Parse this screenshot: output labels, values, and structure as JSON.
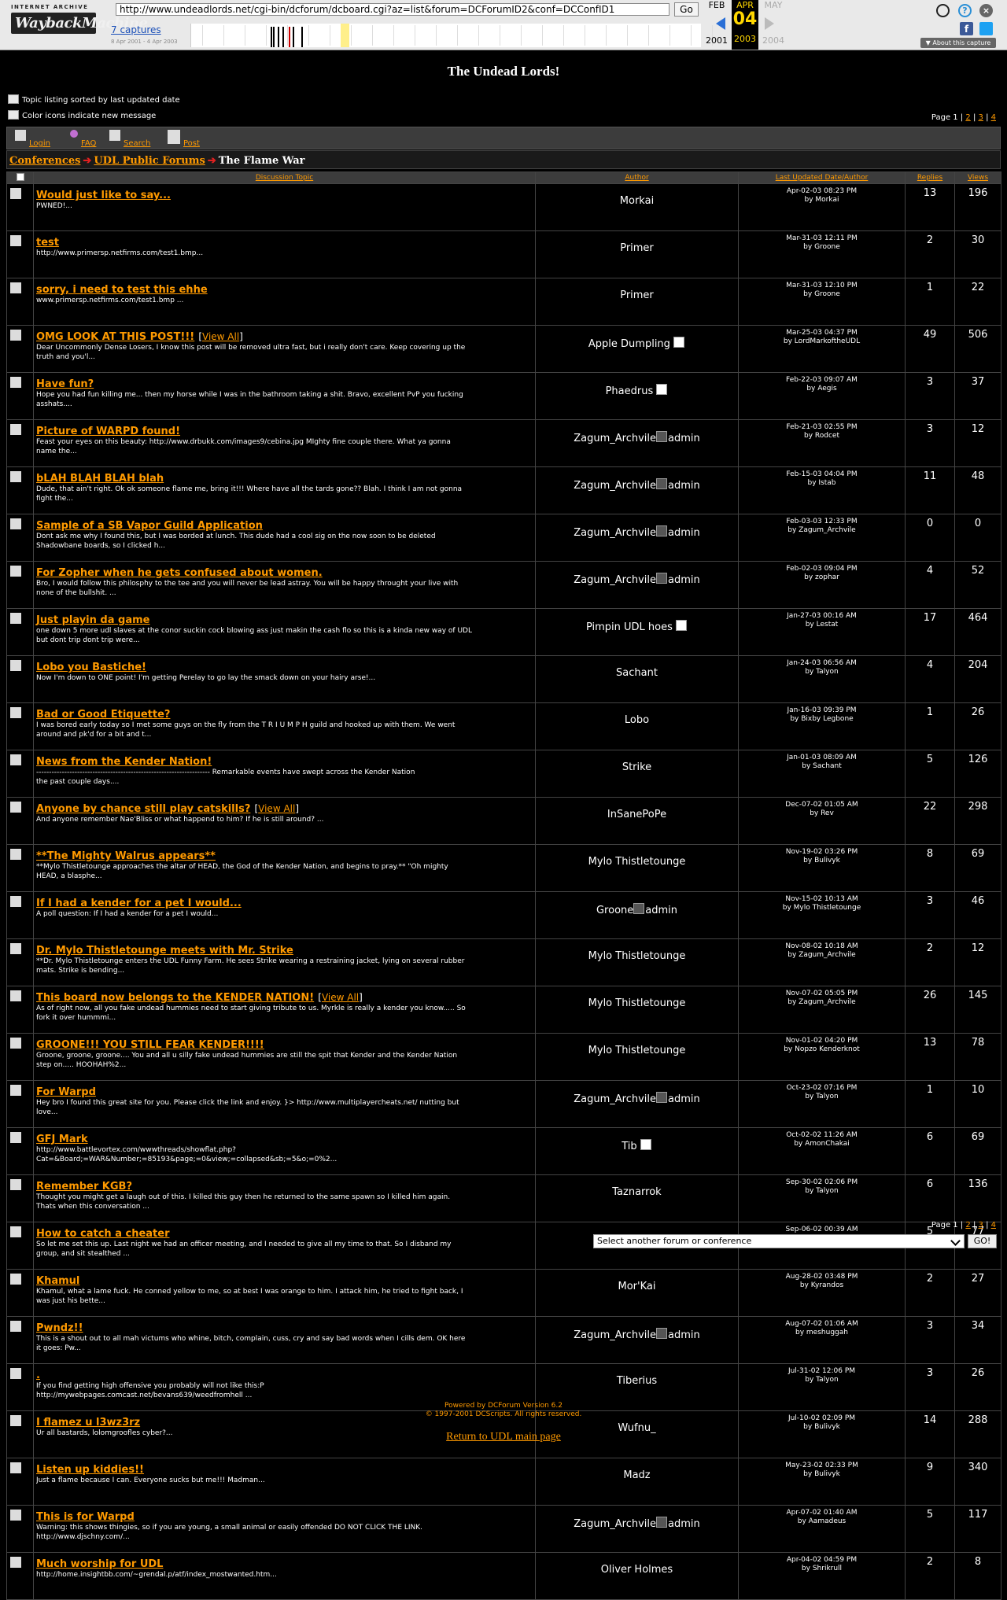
{
  "wayback": {
    "logo_top": "INTERNET ARCHIVE",
    "logo_main": "WaybackMachine",
    "url": "http://www.undeadlords.net/cgi-bin/dcforum/dcboard.cgi?az=list&forum=DCForumID2&conf=DCConfID1",
    "go_label": "Go",
    "captures_label": "7 captures",
    "date_range": "8 Apr 2001 - 4 Apr 2003",
    "prev_month": "FEB",
    "prev_year": "2001",
    "cur_month": "APR",
    "cur_day": "04",
    "cur_year": "2003",
    "next_month": "MAY",
    "next_year": "2004",
    "about_label": "About this capture"
  },
  "forum": {
    "title": "The Undead Lords!",
    "note_sorted": "Topic listing sorted by last updated date",
    "note_icons": "Color icons indicate new message",
    "pages_label": "Page 1",
    "page_links": [
      "2",
      "3",
      "4"
    ],
    "toolbar": {
      "login": "Login",
      "faq": "FAQ",
      "search": "Search",
      "post": "Post"
    },
    "breadcrumb": {
      "conferences": "Conferences",
      "public": "UDL Public Forums",
      "current": "The Flame War"
    },
    "columns": {
      "topic": "Discussion Topic",
      "author": "Author",
      "last_updated": "Last Updated Date/Author",
      "replies": "Replies",
      "views": "Views"
    },
    "select_placeholder": "Select another forum or conference",
    "go_button": "GO!",
    "powered": "Powered by DCForum Version 6.2",
    "copyright": "© 1997-2001 DCScripts. All rights reserved.",
    "return_link": "Return to UDL main page"
  },
  "topics": [
    {
      "title": "Would just like to say...",
      "excerpt": [
        "PWNED!..."
      ],
      "author": "Morkai",
      "date": "Apr-02-03 08:23 PM",
      "by": "by Morkai",
      "replies": "13",
      "views": "196"
    },
    {
      "title": "test",
      "excerpt": [
        "http://www.primersp.netfirms.com/test1.bmp..."
      ],
      "author": "Primer",
      "date": "Mar-31-03 12:11 PM",
      "by": "by Groone",
      "replies": "2",
      "views": "30"
    },
    {
      "title": "sorry, i need to test this ehhe",
      "excerpt": [
        "www.primersp.netfirms.com/test1.bmp ..."
      ],
      "author": "Primer",
      "date": "Mar-31-03 12:10 PM",
      "by": "by Groone",
      "replies": "1",
      "views": "22"
    },
    {
      "title": "OMG LOOK AT THIS POST!!!",
      "view_all": "View All",
      "excerpt": [
        "Dear Uncommonly Dense Losers, I know this post will be removed ultra fast, but i really don't care. Keep covering up the",
        "truth and you'l..."
      ],
      "author": "Apple Dumpling",
      "author_img": true,
      "date": "Mar-25-03 04:37 PM",
      "by": "by LordMarkoftheUDL",
      "replies": "49",
      "views": "506"
    },
    {
      "title": "Have fun?",
      "excerpt": [
        "Hope you had fun killing me... then my horse while I was in the bathroom taking a shit. Bravo, excellent PvP you fucking",
        "asshats...."
      ],
      "author": "Phaedrus",
      "author_img": true,
      "date": "Feb-22-03 09:07 AM",
      "by": "by Aegis",
      "replies": "3",
      "views": "37"
    },
    {
      "title": "Picture of WARPD found!",
      "excerpt": [
        "Feast your eyes on this beauty: http://www.drbukk.com/images9/cebina.jpg MIghty fine couple there. What ya gonna",
        "name the..."
      ],
      "author": "Zagum_Archvile",
      "admin": "admin",
      "date": "Feb-21-03 02:55 PM",
      "by": "by Rodcet",
      "replies": "3",
      "views": "12"
    },
    {
      "title": "bLAH BLAH BLAH blah",
      "excerpt": [
        "Dude, that ain't right. Ok ok someone flame me, bring it!!! Where have all the tards gone?? Blah. I think I am not gonna",
        "fight the..."
      ],
      "author": "Zagum_Archvile",
      "admin": "admin",
      "date": "Feb-15-03 04:04 PM",
      "by": "by Istab",
      "replies": "11",
      "views": "48"
    },
    {
      "title": "Sample of a SB Vapor Guild Application",
      "excerpt": [
        "Dont ask me why I found this, but I was borded at lunch. This dude had a cool sig on the now soon to be deleted",
        "Shadowbane boards, so I clicked h..."
      ],
      "author": "Zagum_Archvile",
      "admin": "admin",
      "date": "Feb-03-03 12:33 PM",
      "by": "by Zagum_Archvile",
      "replies": "0",
      "views": "0"
    },
    {
      "title": "For Zopher when he gets confused about women.",
      "excerpt": [
        "Bro, I would follow this philosphy to the tee and you will never be lead astray. You will be happy throught your live with",
        "none of the bullshit. ..."
      ],
      "author": "Zagum_Archvile",
      "admin": "admin",
      "date": "Feb-02-03 09:04 PM",
      "by": "by zophar",
      "replies": "4",
      "views": "52"
    },
    {
      "title": "Just playin da game",
      "excerpt": [
        "one down 5 more udl slaves at the conor suckin cock blowing ass just makin the cash flo so this is a kinda new way of UDL",
        "but dont trip dont trip were..."
      ],
      "author": "Pimpin UDL hoes",
      "author_img": true,
      "date": "Jan-27-03 00:16 AM",
      "by": "by Lestat",
      "replies": "17",
      "views": "464"
    },
    {
      "title": "Lobo you Bastiche!",
      "excerpt": [
        "Now I'm down to ONE point! I'm getting Perelay to go lay the smack down on your hairy arse!..."
      ],
      "author": "Sachant",
      "date": "Jan-24-03 06:56 AM",
      "by": "by Talyon",
      "replies": "4",
      "views": "204"
    },
    {
      "title": "Bad or Good Etiquette?",
      "excerpt": [
        "I was bored early today so I met some guys on the fly from the T R I U M P H guild and hooked up with them. We went",
        "around and pk'd for a bit and t..."
      ],
      "author": "Lobo",
      "date": "Jan-16-03 09:39 PM",
      "by": "by Bixby Legbone",
      "replies": "1",
      "views": "26"
    },
    {
      "title": "News from the Kender Nation!",
      "excerpt": [
        "-------------------------------------------------------------------- Remarkable events have swept across the Kender Nation",
        "the past couple days...."
      ],
      "author": "Strike",
      "date": "Jan-01-03 08:09 AM",
      "by": "by Sachant",
      "replies": "5",
      "views": "126"
    },
    {
      "title": "Anyone by chance still play catskills?",
      "view_all": "View All",
      "excerpt": [
        "And anyone remember Nae'Bliss or what happend to him? If he is still around? ..."
      ],
      "author": "InSanePoPe",
      "date": "Dec-07-02 01:05 AM",
      "by": "by Rev",
      "replies": "22",
      "views": "298"
    },
    {
      "title": "**The Mighty Walrus appears**",
      "excerpt": [
        "**Mylo Thistletounge approaches the altar of HEAD, the God of the Kender Nation, and begins to pray.** \"Oh mighty",
        "HEAD, a blasphe..."
      ],
      "author": "Mylo Thistletounge",
      "date": "Nov-19-02 03:26 PM",
      "by": "by Bulivyk",
      "replies": "8",
      "views": "69"
    },
    {
      "title": "If I had a kender for a pet I would...",
      "excerpt": [
        "A poll question: If I had a kender for a pet I would..."
      ],
      "author": "Groone",
      "admin": "admin",
      "date": "Nov-15-02 10:13 AM",
      "by": "by Mylo Thistletounge",
      "replies": "3",
      "views": "46"
    },
    {
      "title": "Dr. Mylo Thistletounge meets with Mr. Strike",
      "excerpt": [
        "**Dr. Mylo Thistletounge enters the UDL Funny Farm. He sees Strike wearing a restraining jacket, lying on several rubber",
        "mats. Strike is bending..."
      ],
      "author": "Mylo Thistletounge",
      "date": "Nov-08-02 10:18 AM",
      "by": "by Zagum_Archvile",
      "replies": "2",
      "views": "12"
    },
    {
      "title": "This board now belongs to the KENDER NATION!",
      "view_all": "View All",
      "excerpt": [
        "As of right now, all you fake undead hummies need to start giving tribute to us. Myrkle is really a kender you know..... So",
        "fork it over hummmi..."
      ],
      "author": "Mylo Thistletounge",
      "date": "Nov-07-02 05:05 PM",
      "by": "by Zagum_Archvile",
      "replies": "26",
      "views": "145"
    },
    {
      "title": "GROONE!!! YOU STILL FEAR KENDER!!!!",
      "excerpt": [
        "Groone, groone, groone.... You and all u silly fake undead hummies are still the spit that Kender and the Kender Nation",
        "step on..... HOOHAH%2..."
      ],
      "author": "Mylo Thistletounge",
      "date": "Nov-01-02 04:20 PM",
      "by": "by Nopzo Kenderknot",
      "replies": "13",
      "views": "78"
    },
    {
      "title": "For Warpd",
      "excerpt": [
        "Hey bro I found this great site for you. Please click the link and enjoy. }> http://www.multiplayercheats.net/ nutting but",
        "love..."
      ],
      "author": "Zagum_Archvile",
      "admin": "admin",
      "date": "Oct-23-02 07:16 PM",
      "by": "by Talyon",
      "replies": "1",
      "views": "10"
    },
    {
      "title": "GFJ Mark",
      "excerpt": [
        "http://www.battlevortex.com/wwwthreads/showflat.php?",
        "Cat=&Board;=WAR&Number;=85193&page;=0&view;=collapsed&sb;=5&o;=0%2..."
      ],
      "author": "Tib",
      "author_img": true,
      "date": "Oct-02-02 11:26 AM",
      "by": "by AmonChakai",
      "replies": "6",
      "views": "69"
    },
    {
      "title": "Remember KGB?",
      "excerpt": [
        "Thought you might get a laugh out of this. I killed this guy then he returned to the same spawn so I killed him again.",
        "Thats when this conversation ..."
      ],
      "author": "Taznarrok",
      "date": "Sep-30-02 02:06 PM",
      "by": "by Talyon",
      "replies": "6",
      "views": "136"
    },
    {
      "title": "How to catch a cheater",
      "excerpt": [
        "So let me set this up. Last night we had an officer meeting, and I needed to give all my time to that. So I disband my",
        "group, and sit stealthed ..."
      ],
      "author": "Mor'Kai",
      "date": "Sep-06-02 00:39 AM",
      "by": "by zophar",
      "replies": "5",
      "views": "77"
    },
    {
      "title": "Khamul",
      "excerpt": [
        "Khamul, what a lame fuck. He conned yellow to me, so at best I was orange to him. I attack him, he tried to fight back, I",
        "was just his bette..."
      ],
      "author": "Mor'Kai",
      "date": "Aug-28-02 03:48 PM",
      "by": "by Kyrandos",
      "replies": "2",
      "views": "27"
    },
    {
      "title": "Pwndz!!",
      "excerpt": [
        "This is a shout out to all mah victums who whine, bitch, complain, cuss, cry and say bad words when I cills dem. OK here",
        "it goes: Pw..."
      ],
      "author": "Zagum_Archvile",
      "admin": "admin",
      "date": "Aug-07-02 01:06 AM",
      "by": "by meshuggah",
      "replies": "3",
      "views": "34"
    },
    {
      "title": ".",
      "excerpt": [
        "If you find getting high offensive you probably will not like this:P",
        "http://mywebpages.comcast.net/bevans639/weedfromhell ..."
      ],
      "author": "Tiberius",
      "date": "Jul-31-02 12:06 PM",
      "by": "by Talyon",
      "replies": "3",
      "views": "26"
    },
    {
      "title": "I flamez u l3wz3rz",
      "excerpt": [
        "Ur all bastards, lolomgroofles cyber?..."
      ],
      "author": "Wufnu_",
      "date": "Jul-10-02 02:09 PM",
      "by": "by Bulivyk",
      "replies": "14",
      "views": "288"
    },
    {
      "title": "Listen up kiddies!!",
      "excerpt": [
        "Just a flame because I can. Everyone sucks but me!!! Madman..."
      ],
      "author": "Madz",
      "date": "May-23-02 02:33 PM",
      "by": "by Bulivyk",
      "replies": "9",
      "views": "340"
    },
    {
      "title": "This is for Warpd",
      "excerpt": [
        "Warning: this shows thingies, so if you are young, a small animal or easily offended DO NOT CLICK THE LINK.",
        "http://www.djschny.com/..."
      ],
      "author": "Zagum_Archvile",
      "admin": "admin",
      "date": "Apr-07-02 01:40 AM",
      "by": "by Aamadeus",
      "replies": "5",
      "views": "117"
    },
    {
      "title": "Much worship for UDL",
      "excerpt": [
        "http://home.insightbb.com/~grendal.p/atf/index_mostwanted.htm..."
      ],
      "author": "Oliver Holmes",
      "date": "Apr-04-02 04:59 PM",
      "by": "by Shrikrull",
      "replies": "2",
      "views": "8"
    }
  ]
}
